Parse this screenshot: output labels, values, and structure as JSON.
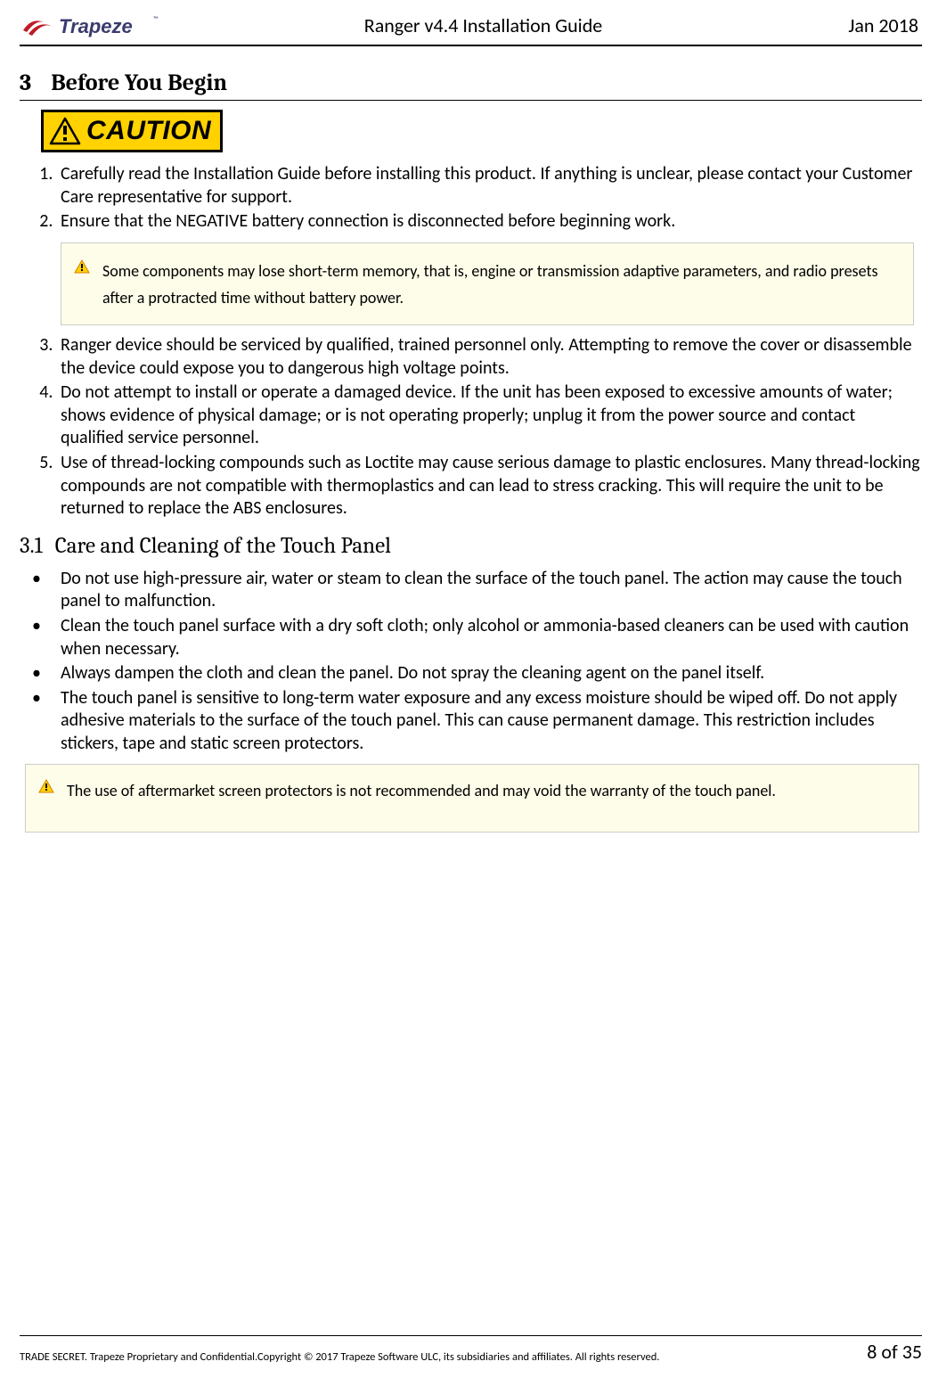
{
  "header": {
    "logo_text": "Trapeze",
    "title": "Ranger v4.4 Installation Guide",
    "date": "Jan 2018"
  },
  "section3": {
    "number": "3",
    "title": "Before You Begin",
    "caution_label": "CAUTION",
    "items": {
      "i1": "Carefully read the Installation Guide before installing this product. If anything is unclear, please contact your Customer Care representative for support.",
      "i2": "Ensure that the NEGATIVE battery connection is disconnected before beginning work.",
      "note1": "Some components may lose short-term memory, that is, engine or transmission adaptive parameters, and radio presets after a protracted time without battery power.",
      "i3": "Ranger device should be serviced by qualified, trained personnel only. Attempting to remove the cover or disassemble the device could expose you to dangerous high voltage points.",
      "i4": "Do not attempt to install or operate a damaged device. If the unit has been exposed to excessive amounts of water; shows evidence of physical damage; or is not operating properly; unplug it from the power source and contact qualified service personnel.",
      "i5": "Use of thread-locking compounds such as Loctite may cause serious damage to plastic enclosures. Many thread-locking compounds are not compatible with thermoplastics and can lead to stress cracking. This will require the unit to be returned to replace the ABS enclosures."
    }
  },
  "section31": {
    "number": "3.1",
    "title": "Care and Cleaning of the Touch Panel",
    "bullets": {
      "b1": "Do not use high-pressure air, water or steam to clean the surface of the touch panel. The action may cause the touch panel to malfunction.",
      "b2": "Clean the touch panel surface with a dry soft cloth; only alcohol or ammonia-based cleaners can be used with caution when necessary.",
      "b3": "Always dampen the cloth and clean the panel. Do not spray the cleaning agent on the panel itself.",
      "b4": "The touch panel is sensitive to long-term water exposure and any excess moisture should be wiped off. Do not apply adhesive materials to the surface of the touch panel. This can cause permanent damage. This restriction includes stickers, tape and static screen protectors."
    },
    "note2": "The use of aftermarket screen protectors is not recommended and may void the warranty of the touch panel."
  },
  "footer": {
    "copyright": "TRADE SECRET. Trapeze Proprietary and Confidential.Copyright © 2017 Trapeze Software ULC, its subsidiaries and affiliates. All rights reserved.",
    "page": "8 of 35"
  }
}
